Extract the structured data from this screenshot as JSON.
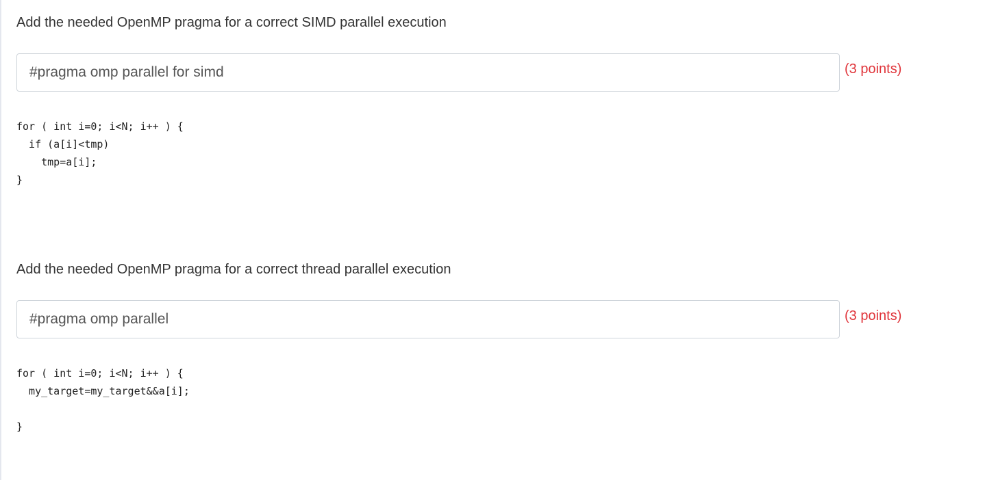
{
  "questions": [
    {
      "prompt": "Add the needed OpenMP pragma for a correct SIMD parallel execution",
      "answer_value": "#pragma omp parallel for simd",
      "points_label": "(3 points)",
      "code_lines": [
        "for ( int i=0; i<N; i++ ) {",
        "  if (a[i]<tmp)",
        "    tmp=a[i];",
        "}"
      ]
    },
    {
      "prompt": "Add the needed OpenMP pragma for a correct thread parallel execution",
      "answer_value": "#pragma omp parallel",
      "points_label": "(3 points)",
      "code_lines": [
        "for ( int i=0; i<N; i++ ) {",
        "  my_target=my_target&&a[i];",
        "",
        "}"
      ]
    }
  ],
  "colors": {
    "points_text": "#e0353b",
    "input_border": "#ced4da"
  }
}
